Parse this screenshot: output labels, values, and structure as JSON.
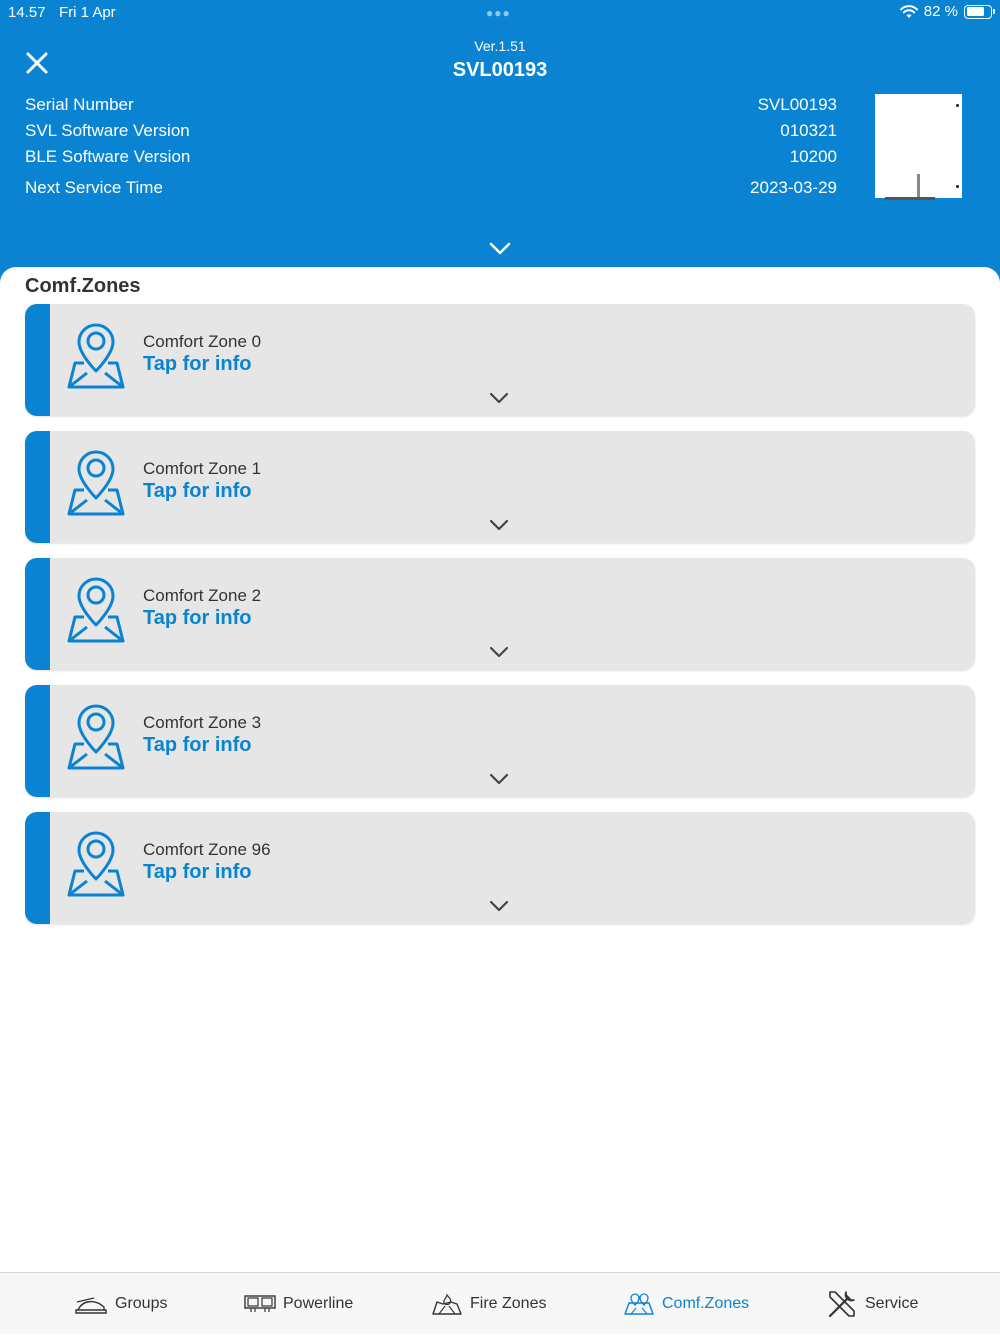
{
  "status_bar": {
    "time": "14.57",
    "date": "Fri 1 Apr",
    "battery": "82 %",
    "battery_level": 0.82
  },
  "header": {
    "version": "Ver.1.51",
    "title": "SVL00193",
    "info": [
      {
        "label": "Serial Number",
        "value": "SVL00193"
      },
      {
        "label": "SVL Software Version",
        "value": "010321"
      },
      {
        "label": "BLE Software Version",
        "value": "10200"
      },
      {
        "label": "Next Service Time",
        "value": "2023-03-29"
      }
    ]
  },
  "section_title": "Comf.Zones",
  "zones": [
    {
      "name": "Comfort Zone 0",
      "link": "Tap for info"
    },
    {
      "name": "Comfort Zone 1",
      "link": "Tap for info"
    },
    {
      "name": "Comfort Zone 2",
      "link": "Tap for info"
    },
    {
      "name": "Comfort Zone 3",
      "link": "Tap for info"
    },
    {
      "name": "Comfort Zone 96",
      "link": "Tap for info"
    }
  ],
  "tabs": [
    {
      "label": "Groups",
      "icon": "groups-icon"
    },
    {
      "label": "Powerline",
      "icon": "powerline-icon"
    },
    {
      "label": "Fire Zones",
      "icon": "fire-zones-icon"
    },
    {
      "label": "Comf.Zones",
      "icon": "comf-zones-icon",
      "active": true
    },
    {
      "label": "Service",
      "icon": "service-icon"
    }
  ],
  "colors": {
    "primary": "#0a84d2",
    "card": "#e6e6e6",
    "text": "#333333"
  }
}
